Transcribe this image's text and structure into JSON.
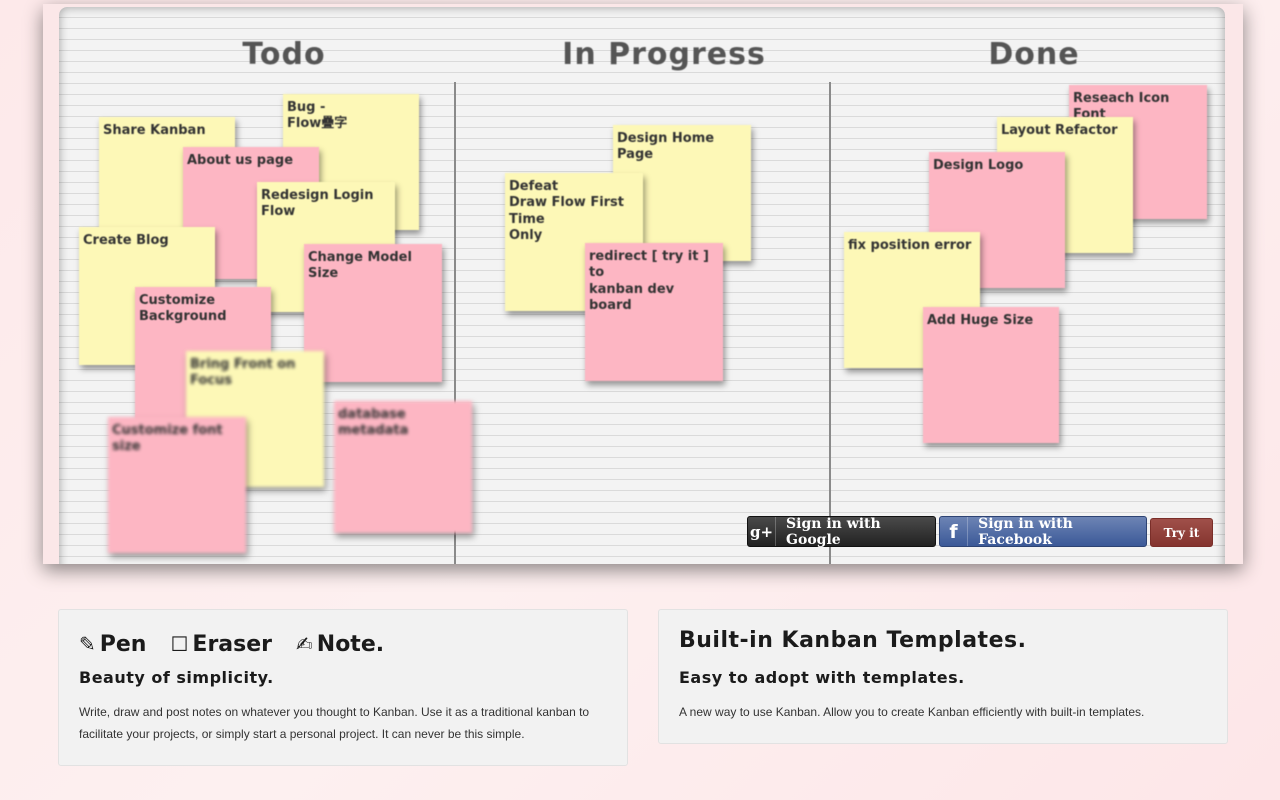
{
  "board": {
    "columns": [
      "Todo",
      "In Progress",
      "Done"
    ],
    "notes": [
      {
        "text": "Share Kanban",
        "color": "yellow"
      },
      {
        "text": "Bug -\nFlow疊字",
        "color": "yellow"
      },
      {
        "text": "About us page",
        "color": "pink"
      },
      {
        "text": "Redesign Login\nFlow",
        "color": "yellow"
      },
      {
        "text": "Create Blog",
        "color": "yellow"
      },
      {
        "text": "Change Model Size",
        "color": "pink"
      },
      {
        "text": "Customize\nBackground",
        "color": "pink"
      },
      {
        "text": "Bring Front on\nFocus",
        "color": "yellow"
      },
      {
        "text": "Customize font size",
        "color": "pink"
      },
      {
        "text": "database metadata",
        "color": "pink"
      },
      {
        "text": "Design Home Page",
        "color": "yellow"
      },
      {
        "text": "Defeat\nDraw Flow First Time\nOnly",
        "color": "yellow"
      },
      {
        "text": "redirect [ try it ] to\nkanban dev board",
        "color": "pink"
      },
      {
        "text": "Reseach Icon Font",
        "color": "pink"
      },
      {
        "text": "Layout Refactor",
        "color": "yellow"
      },
      {
        "text": "Design Logo",
        "color": "pink"
      },
      {
        "text": "fix position error",
        "color": "yellow"
      },
      {
        "text": "Add Huge Size",
        "color": "pink"
      }
    ]
  },
  "auth": {
    "google_icon": "g+",
    "google_label": "Sign in with Google",
    "facebook_icon": "f",
    "facebook_label": "Sign in with Facebook",
    "try_label": "Try it"
  },
  "features": {
    "left": {
      "tools": [
        {
          "icon": "pencil-icon",
          "glyph": "✎",
          "label": "Pen"
        },
        {
          "icon": "square-icon",
          "glyph": "☐",
          "label": "Eraser"
        },
        {
          "icon": "edit-icon",
          "glyph": "✍",
          "label": "Note."
        }
      ],
      "subtitle": "Beauty of simplicity.",
      "body": "Write, draw and post notes on whatever you thought to Kanban. Use it as a traditional kanban to facilitate your projects, or simply start a personal project. It can never be this simple."
    },
    "right": {
      "title": "Built-in Kanban Templates.",
      "subtitle": "Easy to adopt with templates.",
      "body": "A new way to use Kanban. Allow you to create Kanban efficiently with built-in templates."
    }
  },
  "colors": {
    "note_yellow": "#fdf8b7",
    "note_pink": "#fdb6c3",
    "google_btn": "#2b2b2b",
    "facebook_btn": "#3b5998",
    "try_btn": "#8f3d37"
  }
}
